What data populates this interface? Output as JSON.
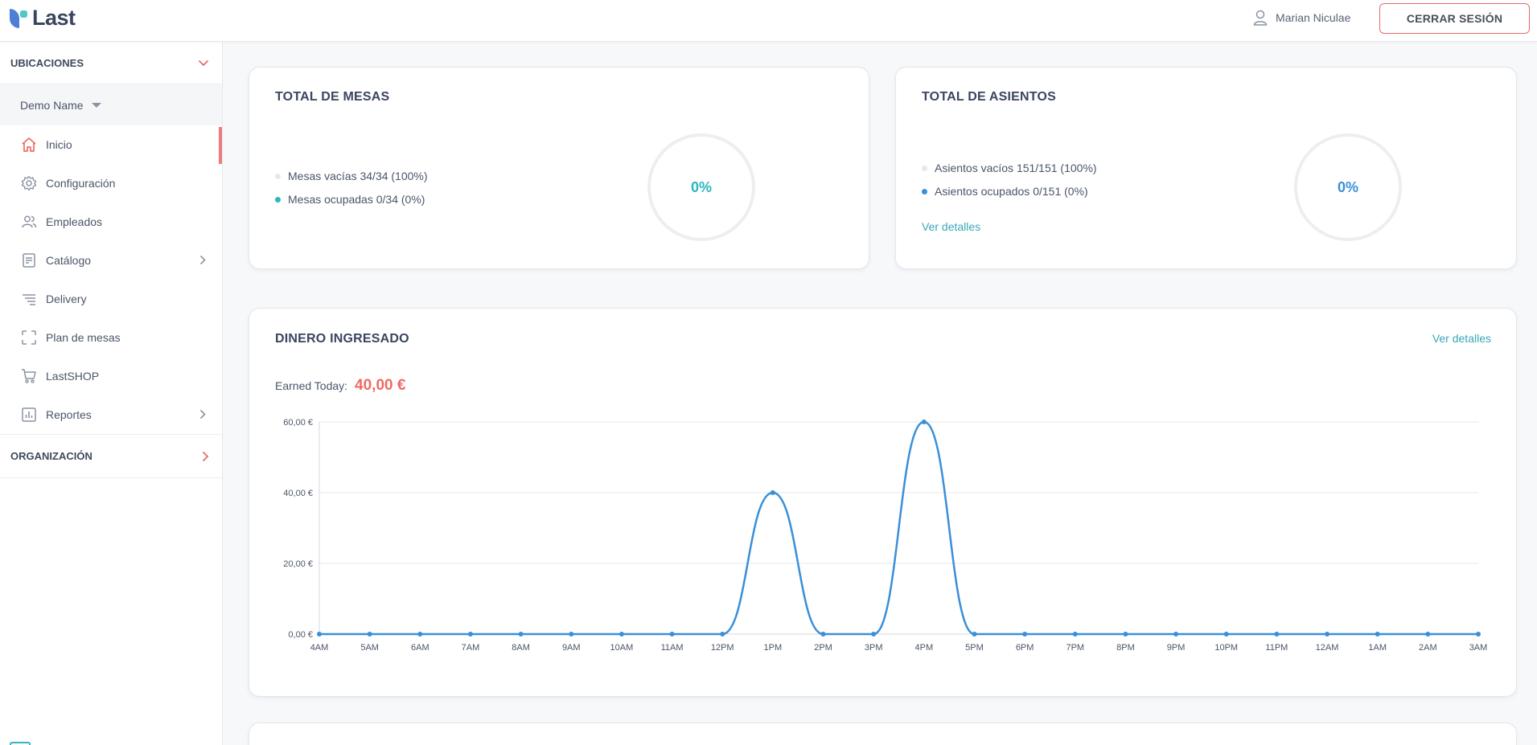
{
  "header": {
    "logo_text": "Last",
    "user_name": "Marian Niculae",
    "logout_label": "CERRAR SESIÓN"
  },
  "sidebar": {
    "locations_label": "UBICACIONES",
    "location_name": "Demo Name",
    "items": [
      {
        "label": "Inicio",
        "icon": "home-icon",
        "active": true
      },
      {
        "label": "Configuración",
        "icon": "gear-icon"
      },
      {
        "label": "Empleados",
        "icon": "users-icon"
      },
      {
        "label": "Catálogo",
        "icon": "document-icon",
        "has_submenu": true
      },
      {
        "label": "Delivery",
        "icon": "list-lines-icon"
      },
      {
        "label": "Plan de mesas",
        "icon": "frame-icon"
      },
      {
        "label": "LastSHOP",
        "icon": "cart-icon"
      },
      {
        "label": "Reportes",
        "icon": "bar-chart-icon",
        "has_submenu": true
      }
    ],
    "organization_label": "ORGANIZACIÓN"
  },
  "tables_card": {
    "title": "TOTAL DE MESAS",
    "empty": "Mesas vacías 34/34 (100%)",
    "occupied": "Mesas ocupadas 0/34 (0%)",
    "percent": "0%",
    "colors": {
      "empty": "#e6e8ec",
      "occupied": "#2ab7c0",
      "percent": "#2ab7c0"
    }
  },
  "seats_card": {
    "title": "TOTAL DE ASIENTOS",
    "empty": "Asientos vacíos 151/151 (100%)",
    "occupied": "Asientos ocupados 0/151 (0%)",
    "details_link": "Ver detalles",
    "percent": "0%",
    "colors": {
      "empty": "#e6e8ec",
      "occupied": "#3a8fd8",
      "percent": "#3a8fd8"
    }
  },
  "revenue_card": {
    "title": "DINERO INGRESADO",
    "details_link": "Ver detalles",
    "earned_label": "Earned Today:",
    "earned_value": "40,00 €"
  },
  "chart_data": {
    "type": "line",
    "categories": [
      "4AM",
      "5AM",
      "6AM",
      "7AM",
      "8AM",
      "9AM",
      "10AM",
      "11AM",
      "12PM",
      "1PM",
      "2PM",
      "3PM",
      "4PM",
      "5PM",
      "6PM",
      "7PM",
      "8PM",
      "9PM",
      "10PM",
      "11PM",
      "12AM",
      "1AM",
      "2AM",
      "3AM"
    ],
    "series": [
      {
        "values": [
          0,
          0,
          0,
          0,
          0,
          0,
          0,
          0,
          0,
          40,
          0,
          0,
          60,
          0,
          0,
          0,
          0,
          0,
          0,
          0,
          0,
          0,
          0,
          0
        ]
      }
    ],
    "y_ticks": [
      "0,00 €",
      "20,00 €",
      "40,00 €",
      "60,00 €"
    ],
    "ylim": [
      0,
      60
    ],
    "grid": true,
    "color": "#3a8fd8"
  }
}
